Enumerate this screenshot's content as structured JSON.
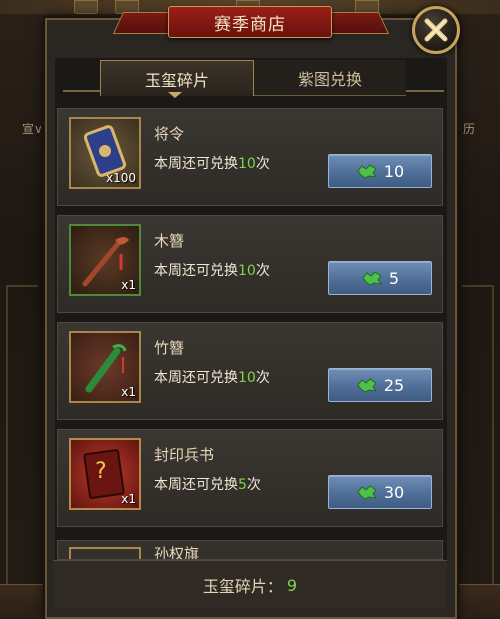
{
  "title": "赛季商店",
  "tabs": [
    {
      "label": "玉玺碎片",
      "active": true
    },
    {
      "label": "紫图兑换",
      "active": false
    }
  ],
  "background": {
    "left_text": "宣∨",
    "right_text": "历"
  },
  "items": [
    {
      "name": "将令",
      "quantity": "x100",
      "limit_prefix": "本周还可兑换",
      "limit_count": "10",
      "limit_suffix": "次",
      "price": "10",
      "icon": "token-icon"
    },
    {
      "name": "木簪",
      "quantity": "x1",
      "limit_prefix": "本周还可兑换",
      "limit_count": "10",
      "limit_suffix": "次",
      "price": "5",
      "icon": "wooden-hairpin-icon"
    },
    {
      "name": "竹簪",
      "quantity": "x1",
      "limit_prefix": "本周还可兑换",
      "limit_count": "10",
      "limit_suffix": "次",
      "price": "25",
      "icon": "bamboo-hairpin-icon"
    },
    {
      "name": "封印兵书",
      "quantity": "x1",
      "limit_prefix": "本周还可兑换",
      "limit_count": "5",
      "limit_suffix": "次",
      "price": "30",
      "icon": "sealed-book-icon"
    }
  ],
  "peek_item": {
    "name": "孙权旗"
  },
  "footer": {
    "label": "玉玺碎片：",
    "value": "9"
  },
  "colors": {
    "highlight_green": "#7fd44a",
    "button_blue": "#4f6f98",
    "title_red": "#9b1f17",
    "frame_gold": "#c9a25b"
  }
}
